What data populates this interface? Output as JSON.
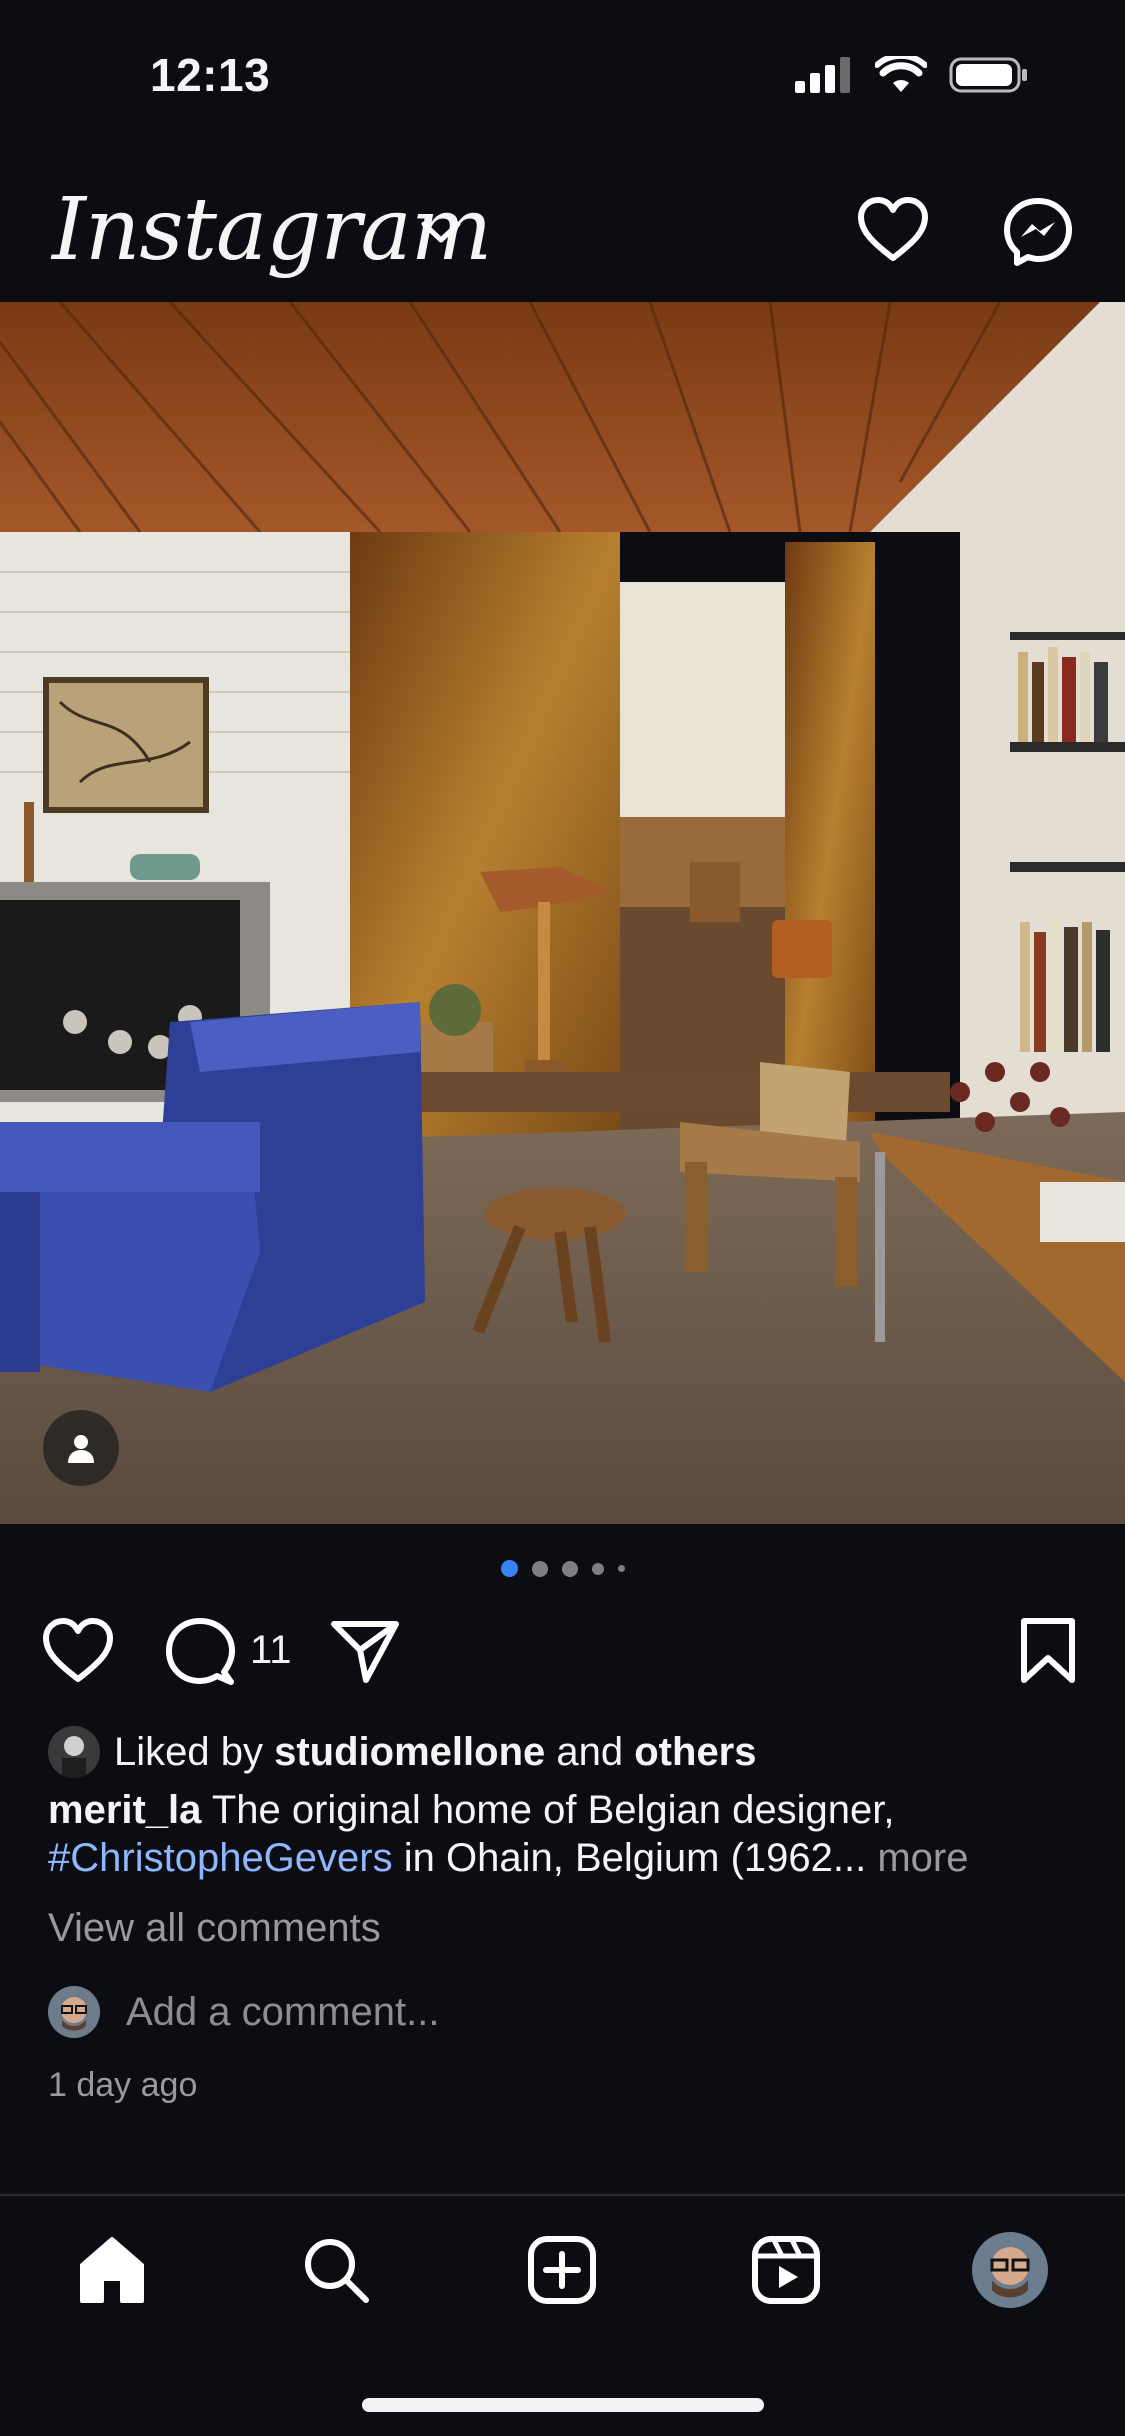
{
  "status": {
    "time": "12:13"
  },
  "header": {
    "logo_text": "Instagram"
  },
  "post": {
    "comment_count": "11",
    "carousel": {
      "total": 5,
      "active_index": 0
    },
    "liked_by": {
      "prefix": "Liked by",
      "user": "studiomellone",
      "joiner": "and",
      "others": "others"
    },
    "caption": {
      "username": "merit_la",
      "text": "The original home of Belgian designer,",
      "hashtag": "#ChristopheGevers",
      "text2": "in Ohain, Belgium (1962...",
      "more": "more"
    },
    "view_all_comments": "View all comments",
    "add_comment_placeholder": "Add a comment...",
    "timestamp": "1 day ago"
  },
  "colors": {
    "background": "#0b0d12",
    "accent": "#3b82f6",
    "hashtag": "#8fb7ff",
    "muted": "#9a9a9a"
  },
  "icons": [
    "heart-icon",
    "messenger-icon",
    "comment-icon",
    "share-icon",
    "bookmark-icon",
    "home-icon",
    "search-icon",
    "create-icon",
    "reels-icon",
    "user-tag-icon"
  ]
}
